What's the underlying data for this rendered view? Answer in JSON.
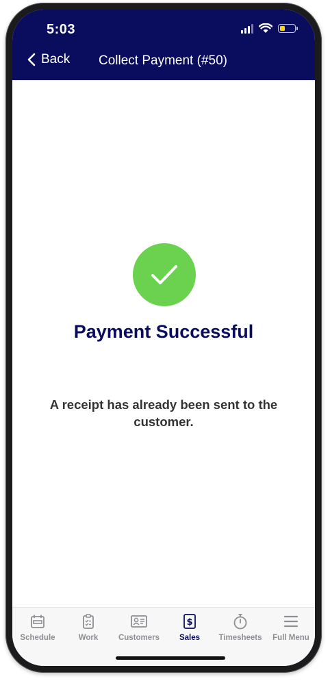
{
  "status_bar": {
    "time": "5:03"
  },
  "header": {
    "back_label": "Back",
    "title": "Collect Payment (#50)"
  },
  "main": {
    "title": "Payment Successful",
    "message": "A receipt has already been sent to the customer."
  },
  "tabs": [
    {
      "label": "Schedule",
      "icon": "calendar-icon"
    },
    {
      "label": "Work",
      "icon": "clipboard-icon"
    },
    {
      "label": "Customers",
      "icon": "contact-card-icon"
    },
    {
      "label": "Sales",
      "icon": "dollar-icon",
      "active": true
    },
    {
      "label": "Timesheets",
      "icon": "stopwatch-icon"
    },
    {
      "label": "Full Menu",
      "icon": "hamburger-icon"
    }
  ],
  "colors": {
    "brand_navy": "#0a0c5e",
    "success_green": "#6bd24f",
    "tab_inactive": "#8e8e93"
  }
}
